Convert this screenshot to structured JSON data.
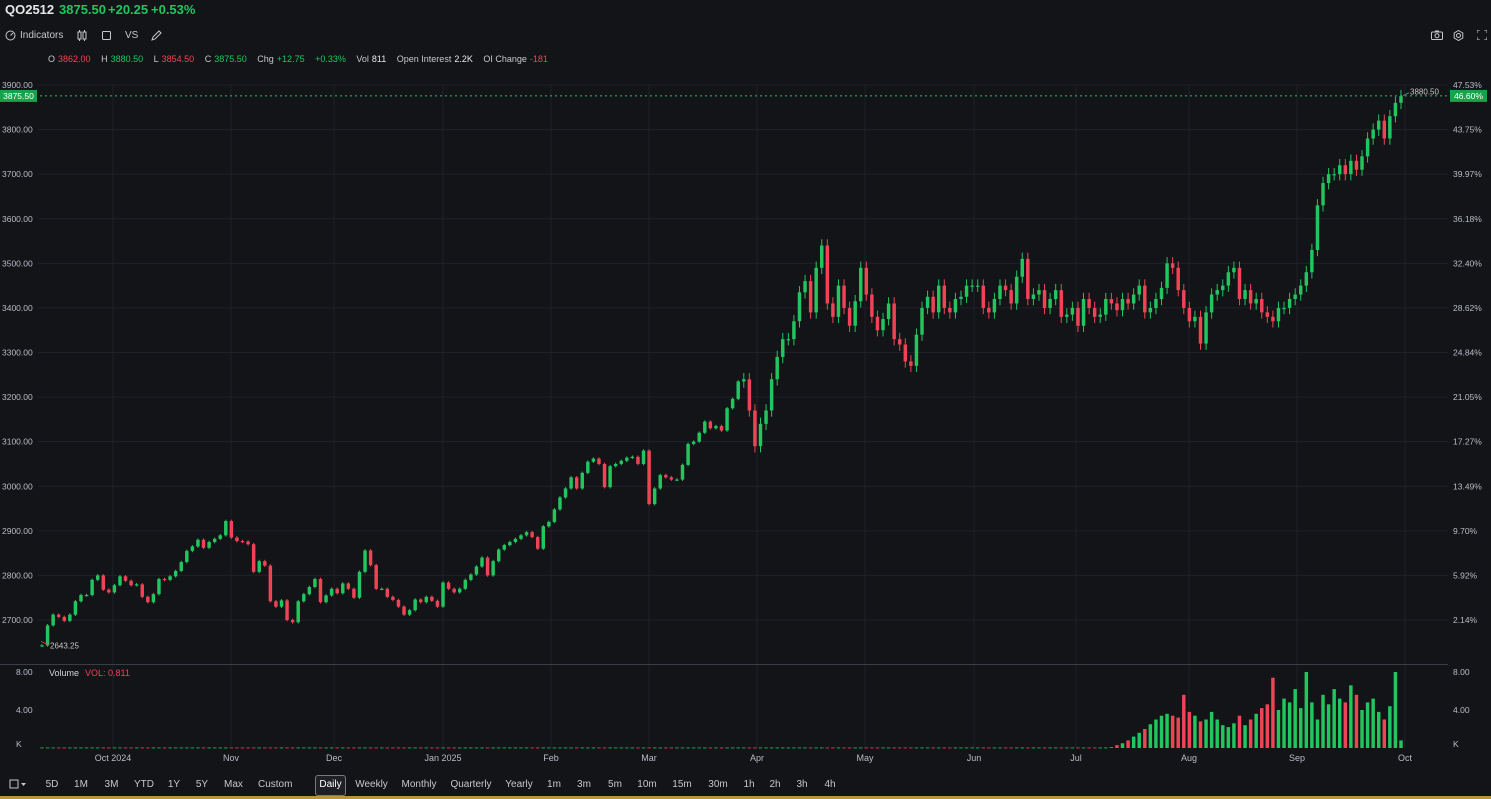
{
  "header": {
    "symbol": "QO2512",
    "last": "3875.50",
    "change": "+20.25",
    "change_pct": "+0.53%"
  },
  "toolbar": {
    "indicators_label": "Indicators",
    "compare_label": "VS",
    "icons": [
      "indicators-icon",
      "candles-icon",
      "square-icon",
      "pencil-icon",
      "camera-icon",
      "gear-icon",
      "fullscreen-icon"
    ]
  },
  "ohlc": {
    "o_label": "O",
    "o": "3862.00",
    "h_label": "H",
    "h": "3880.50",
    "l_label": "L",
    "l": "3854.50",
    "c_label": "C",
    "c": "3875.50",
    "chg_label": "Chg",
    "chg": "+12.75",
    "chg_pct": "+0.33%",
    "vol_label": "Vol",
    "vol": "811",
    "oi_label": "Open Interest",
    "oi": "2.2K",
    "oic_label": "OI Change",
    "oic": "-181"
  },
  "price_axis": {
    "ticks": [
      "3900.00",
      "3800.00",
      "3700.00",
      "3600.00",
      "3500.00",
      "3400.00",
      "3300.00",
      "3200.00",
      "3100.00",
      "3000.00",
      "2900.00",
      "2800.00",
      "2700.00"
    ],
    "current_label": "3875.50"
  },
  "pct_axis": {
    "ticks": [
      "47.53%",
      "43.75%",
      "39.97%",
      "36.18%",
      "32.40%",
      "28.62%",
      "24.84%",
      "21.05%",
      "17.27%",
      "13.49%",
      "9.70%",
      "5.92%",
      "2.14%"
    ],
    "current_label": "46.60%"
  },
  "annotations": {
    "high": "3880.50",
    "low": "2643.25"
  },
  "volume_panel": {
    "title": "Volume",
    "value_label": "VOL: 0.811",
    "ticks_left": [
      "8.00",
      "4.00",
      "K"
    ],
    "ticks_right": [
      "8.00",
      "4.00",
      "K"
    ]
  },
  "x_axis": {
    "labels": [
      "Oct 2024",
      "Nov",
      "Dec",
      "Jan 2025",
      "Feb",
      "Mar",
      "Apr",
      "May",
      "Jun",
      "Jul",
      "Aug",
      "Sep",
      "Oct"
    ]
  },
  "bottom_bar": {
    "ranges": [
      "5D",
      "1M",
      "3M",
      "YTD",
      "1Y",
      "5Y",
      "Max",
      "Custom"
    ],
    "intervals": [
      "Daily",
      "Weekly",
      "Monthly",
      "Quarterly",
      "Yearly",
      "1m",
      "3m",
      "5m",
      "10m",
      "15m",
      "30m",
      "1h",
      "2h",
      "3h",
      "4h"
    ],
    "active": "Daily"
  },
  "colors": {
    "up": "#22c55e",
    "down": "#ef4456",
    "background": "#131418",
    "accent_bottom": "#b8953a"
  },
  "chart_data": {
    "type": "candlestick",
    "symbol": "QO2512",
    "ylim": [
      2630,
      3915
    ],
    "y_ticks": [
      2700,
      2800,
      2900,
      3000,
      3100,
      3200,
      3300,
      3400,
      3500,
      3600,
      3700,
      3800,
      3900
    ],
    "current_price": 3875.5,
    "high_marker": 3880.5,
    "low_marker": 2643.25,
    "x_months": [
      "Oct 2024",
      "Nov",
      "Dec",
      "Jan 2025",
      "Feb",
      "Mar",
      "Apr",
      "May",
      "Jun",
      "Jul",
      "Aug",
      "Sep",
      "Oct"
    ],
    "closes": [
      2643,
      2688,
      2712,
      2707,
      2698,
      2712,
      2742,
      2756,
      2756,
      2790,
      2800,
      2768,
      2762,
      2778,
      2798,
      2788,
      2778,
      2780,
      2752,
      2740,
      2758,
      2792,
      2790,
      2798,
      2810,
      2830,
      2855,
      2865,
      2880,
      2862,
      2875,
      2882,
      2890,
      2922,
      2885,
      2877,
      2876,
      2870,
      2808,
      2832,
      2822,
      2742,
      2730,
      2744,
      2700,
      2695,
      2742,
      2758,
      2774,
      2792,
      2740,
      2755,
      2770,
      2760,
      2782,
      2770,
      2750,
      2808,
      2856,
      2823,
      2770,
      2770,
      2752,
      2745,
      2730,
      2712,
      2722,
      2746,
      2740,
      2752,
      2743,
      2730,
      2784,
      2770,
      2762,
      2770,
      2790,
      2802,
      2820,
      2840,
      2800,
      2832,
      2858,
      2868,
      2875,
      2882,
      2890,
      2897,
      2886,
      2860,
      2910,
      2920,
      2948,
      2975,
      2995,
      3020,
      2995,
      3030,
      3055,
      3062,
      3050,
      2998,
      3045,
      3050,
      3057,
      3064,
      3066,
      3050,
      3080,
      2960,
      2995,
      3025,
      3020,
      3015,
      3015,
      3048,
      3095,
      3100,
      3120,
      3145,
      3130,
      3135,
      3125,
      3175,
      3196,
      3235,
      3240,
      3170,
      3090,
      3140,
      3170,
      3240,
      3290,
      3330,
      3330,
      3370,
      3435,
      3460,
      3390,
      3490,
      3540,
      3410,
      3380,
      3450,
      3400,
      3360,
      3415,
      3490,
      3430,
      3380,
      3350,
      3375,
      3410,
      3330,
      3318,
      3280,
      3270,
      3340,
      3400,
      3425,
      3390,
      3450,
      3400,
      3390,
      3420,
      3425,
      3450,
      3450,
      3450,
      3400,
      3390,
      3420,
      3450,
      3440,
      3410,
      3470,
      3510,
      3420,
      3430,
      3440,
      3400,
      3420,
      3440,
      3380,
      3385,
      3400,
      3360,
      3420,
      3400,
      3380,
      3385,
      3420,
      3410,
      3395,
      3420,
      3410,
      3430,
      3450,
      3390,
      3400,
      3420,
      3445,
      3500,
      3490,
      3440,
      3400,
      3370,
      3380,
      3320,
      3390,
      3430,
      3440,
      3450,
      3480,
      3490,
      3420,
      3440,
      3410,
      3420,
      3390,
      3380,
      3370,
      3400,
      3400,
      3420,
      3430,
      3450,
      3480,
      3530,
      3630,
      3680,
      3700,
      3700,
      3720,
      3700,
      3730,
      3710,
      3740,
      3780,
      3800,
      3820,
      3780,
      3830,
      3860,
      3875
    ],
    "volume": {
      "ylim": [
        0,
        8
      ],
      "unit": "K",
      "values_last_days": [
        0.1,
        0.3,
        0.5,
        0.8,
        1.2,
        1.6,
        2.0,
        2.5,
        3.0,
        3.4,
        3.6,
        3.4,
        3.2,
        5.6,
        3.8,
        3.4,
        2.8,
        3.0,
        3.8,
        3.0,
        2.4,
        2.2,
        2.6,
        3.4,
        2.4,
        3.0,
        3.6,
        4.2,
        4.6,
        7.4,
        4.0,
        5.2,
        4.8,
        6.2,
        4.2,
        8.0,
        4.8,
        3.0,
        5.6,
        4.6,
        6.2,
        5.2,
        4.8,
        6.6,
        5.6,
        4.0,
        4.8,
        5.2,
        3.8,
        3.0,
        4.4,
        8.0,
        0.8
      ],
      "latest": 0.811
    }
  }
}
